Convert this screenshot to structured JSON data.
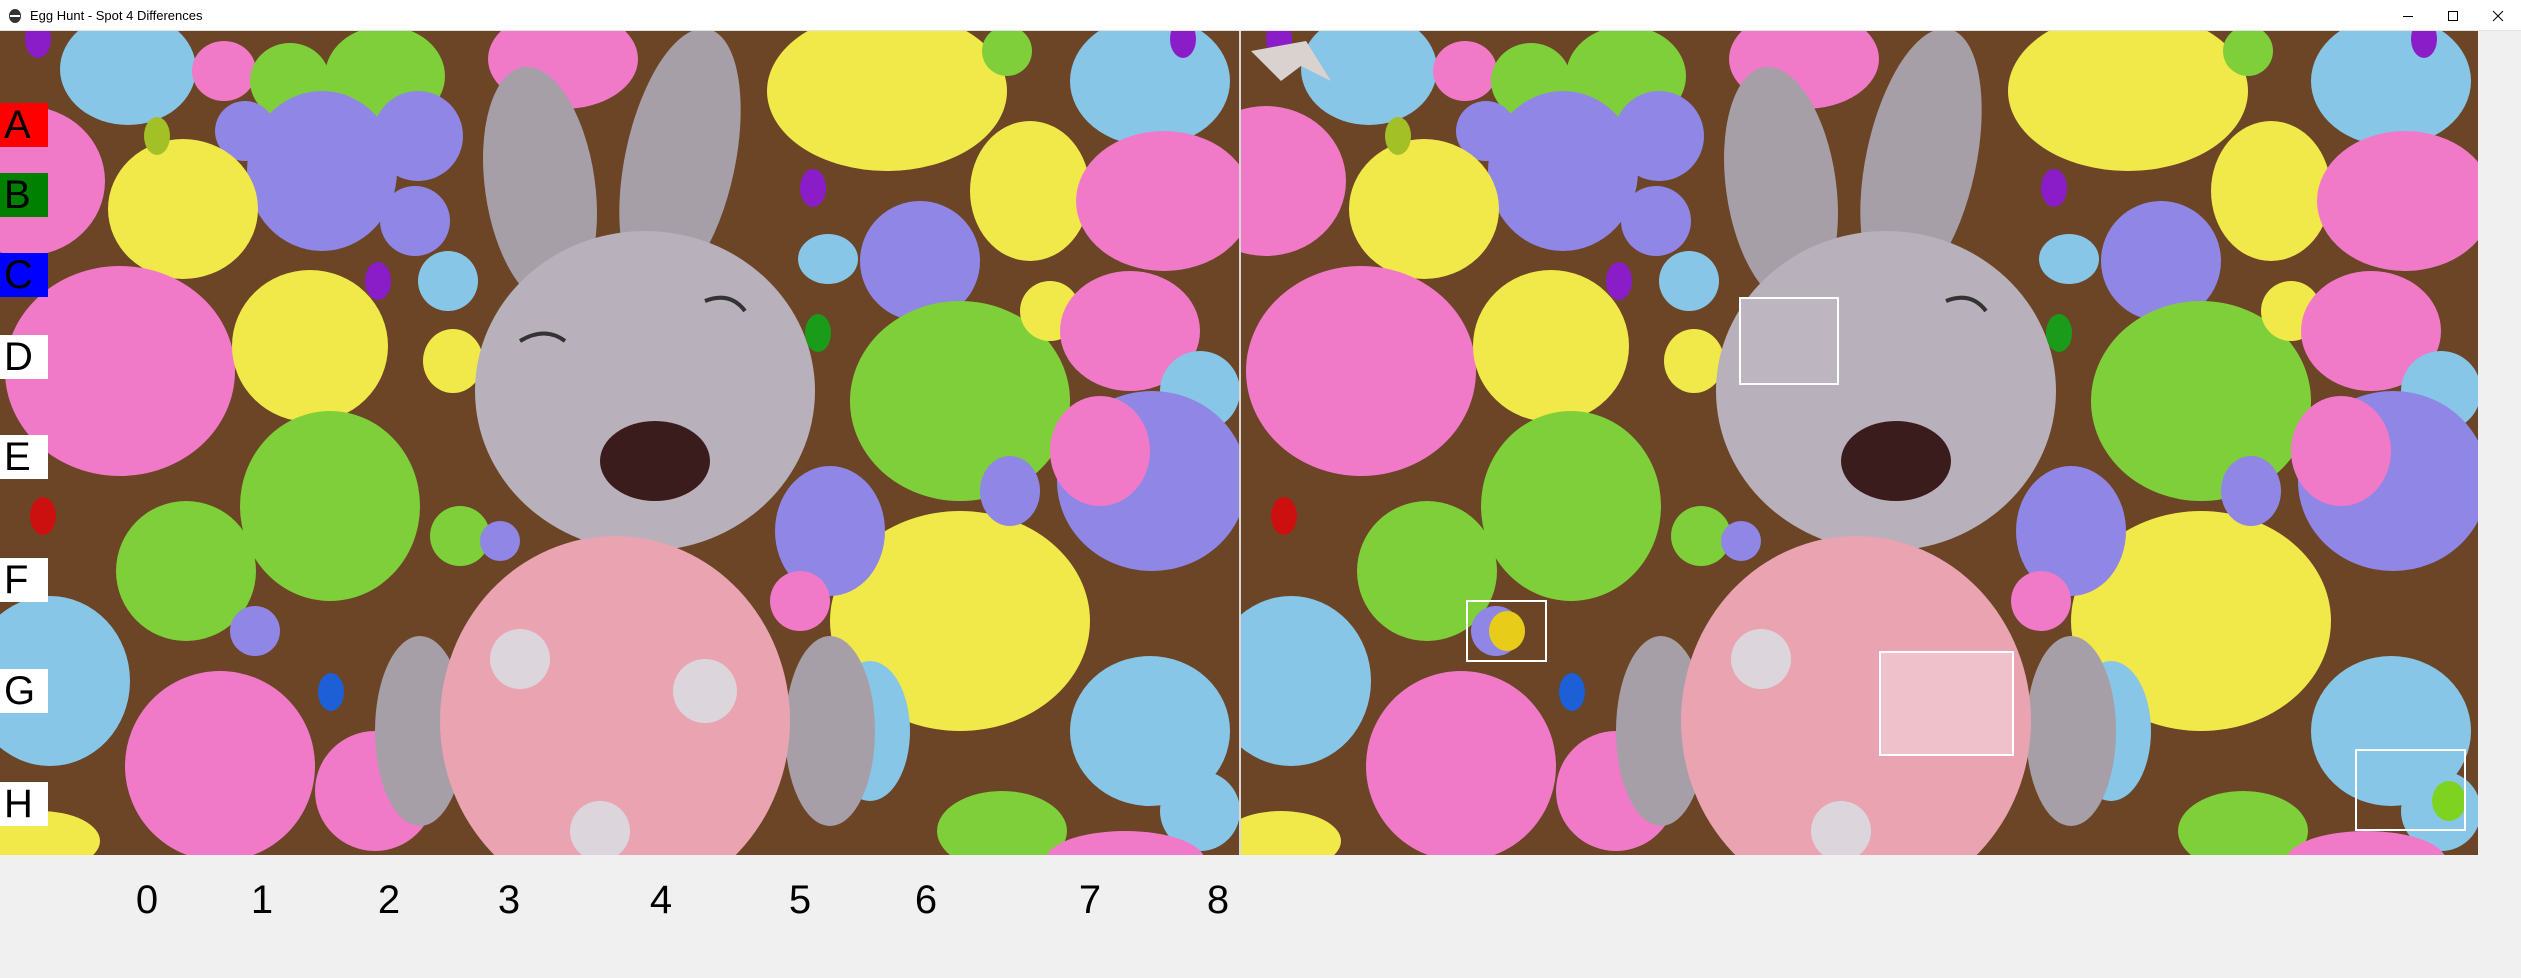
{
  "window": {
    "title": "Egg Hunt - Spot 4 Differences",
    "icon": "egg-icon",
    "controls": [
      "minimize-icon",
      "maximize-icon",
      "close-icon"
    ]
  },
  "grid": {
    "rows": [
      {
        "letter": "A",
        "bg": "#ff0000",
        "color": "#000000"
      },
      {
        "letter": "B",
        "bg": "#008000",
        "color": "#000000"
      },
      {
        "letter": "C",
        "bg": "#0000ff",
        "color": "#000000"
      },
      {
        "letter": "D",
        "bg": "#ffffff",
        "color": "#000000"
      },
      {
        "letter": "E",
        "bg": "#ffffff",
        "color": "#000000"
      },
      {
        "letter": "F",
        "bg": "#ffffff",
        "color": "#000000"
      },
      {
        "letter": "G",
        "bg": "#ffffff",
        "color": "#000000"
      },
      {
        "letter": "H",
        "bg": "#ffffff",
        "color": "#000000"
      }
    ],
    "columns": [
      "0",
      "1",
      "2",
      "3",
      "4",
      "5",
      "6",
      "7",
      "8"
    ]
  },
  "colors": {
    "pink": "#f07ac8",
    "yellow": "#f1e94a",
    "green": "#7fcf3a",
    "blue": "#88c6e8",
    "purple": "#8f86e6",
    "bunny": "#a69fa8",
    "egg": "#e9a3b1",
    "wood": "#6b4526"
  },
  "differences": {
    "found_count": 4
  }
}
